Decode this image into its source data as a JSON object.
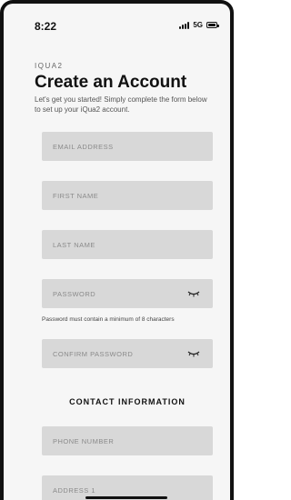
{
  "status_bar": {
    "time": "8:22",
    "network": "5G",
    "signal_icon": "signal-bars-icon",
    "battery_icon": "battery-icon"
  },
  "header": {
    "brand": "IQUA2",
    "title": "Create an Account",
    "subtitle": "Let's get you started! Simply complete the form below to set up your iQua2 account."
  },
  "form": {
    "email_placeholder": "EMAIL ADDRESS",
    "first_name_placeholder": "FIRST NAME",
    "last_name_placeholder": "LAST NAME",
    "password_placeholder": "PASSWORD",
    "password_hint": "Password must contain a minimum of 8 characters",
    "confirm_password_placeholder": "CONFIRM PASSWORD",
    "toggle_icon": "eye-closed-icon"
  },
  "contact": {
    "section_title": "CONTACT INFORMATION",
    "phone_placeholder": "PHONE NUMBER",
    "address1_placeholder": "ADDRESS 1"
  },
  "colors": {
    "field_bg": "#d8d8d8",
    "screen_bg": "#f6f6f6",
    "text_primary": "#111111"
  }
}
